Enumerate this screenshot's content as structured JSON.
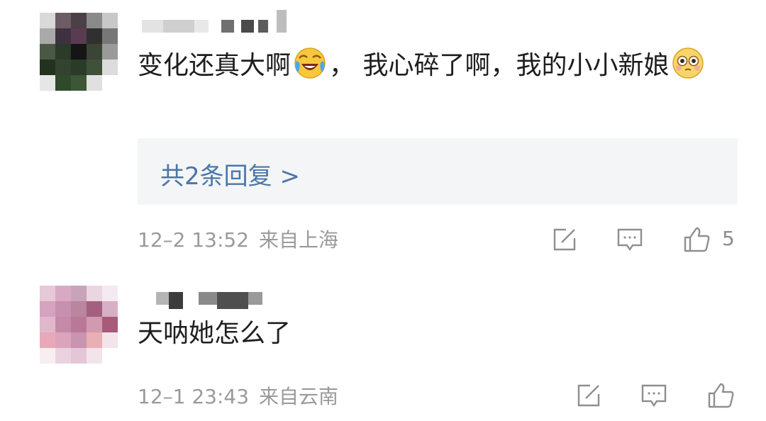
{
  "comments": [
    {
      "text_before_emoji_1": "变化还真大啊",
      "emoji_1": "laugh-cry-emoji",
      "text_mid": "，  我心碎了啊，我的小小新娘",
      "emoji_2": "pleading-emoji",
      "replies_label": "共2条回复 >",
      "time": "12–2 13:52",
      "location": "来自上海",
      "like_count": "5"
    },
    {
      "text": "天呐她怎么了",
      "time": "12–1 23:43",
      "location": "来自云南"
    }
  ],
  "icons": {
    "share": "share-icon",
    "comment": "comment-icon",
    "like": "like-icon"
  },
  "colors": {
    "link": "#4a76a8",
    "meta": "#9a9a9a",
    "reply_bg": "#f4f5f7",
    "icon": "#8f8f8f"
  }
}
